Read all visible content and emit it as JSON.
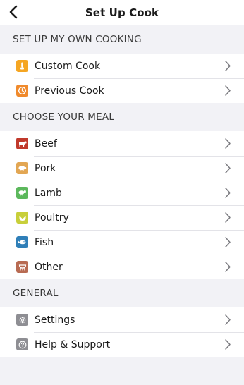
{
  "header": {
    "title": "Set Up Cook",
    "back_icon": "chevron-left-icon"
  },
  "sections": [
    {
      "title": "SET UP MY OWN COOKING",
      "items": [
        {
          "label": "Custom Cook",
          "icon": "custom-cook-icon",
          "color": "#f5a623"
        },
        {
          "label": "Previous Cook",
          "icon": "clock-history-icon",
          "color": "#f08a2c"
        }
      ]
    },
    {
      "title": "CHOOSE YOUR MEAL",
      "items": [
        {
          "label": "Beef",
          "icon": "cow-icon",
          "color": "#c0392b"
        },
        {
          "label": "Pork",
          "icon": "pig-icon",
          "color": "#e2a653"
        },
        {
          "label": "Lamb",
          "icon": "sheep-icon",
          "color": "#5cb85c"
        },
        {
          "label": "Poultry",
          "icon": "chicken-icon",
          "color": "#c8cf3a"
        },
        {
          "label": "Fish",
          "icon": "fish-icon",
          "color": "#2f7fb8"
        },
        {
          "label": "Other",
          "icon": "grill-icon",
          "color": "#b86b52"
        }
      ]
    },
    {
      "title": "GENERAL",
      "items": [
        {
          "label": "Settings",
          "icon": "gear-icon",
          "color": "#8e8e93"
        },
        {
          "label": "Help & Support",
          "icon": "question-icon",
          "color": "#8e8e93"
        }
      ]
    }
  ]
}
